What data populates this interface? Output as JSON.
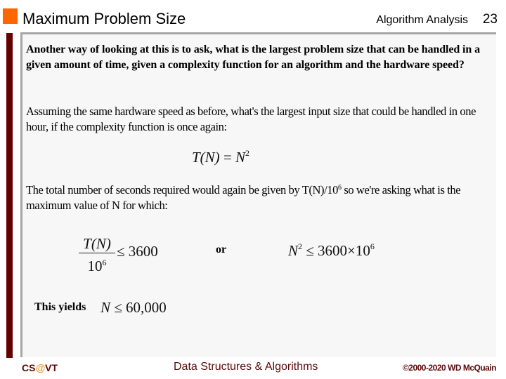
{
  "header": {
    "title": "Maximum Problem Size",
    "section": "Algorithm Analysis",
    "slide_number": "23",
    "accent_color": "#ff6600",
    "bar_color": "#660000"
  },
  "body": {
    "paragraph1": "Another way of looking at this is to ask, what is the largest problem size that can be handled in a given amount of time, given a complexity function for an algorithm and the hardware speed?",
    "paragraph2": "Assuming the same hardware speed as before, what's the largest input size that could be handled in one hour, if the complexity function is once again:",
    "equation1": {
      "lhs": "T(N)",
      "op": " = ",
      "rhs_base": "N",
      "rhs_exp": "2"
    },
    "paragraph3_pre": "The total number of seconds required would again be given by T(N)/10",
    "paragraph3_exp": "6",
    "paragraph3_post": " so we're asking what is the maximum value of N for which:",
    "inequality1": {
      "numerator": "T(N)",
      "denominator_base": "10",
      "denominator_exp": "6",
      "rhs": "≤ 3600"
    },
    "or_label": "or",
    "inequality2": {
      "lhs_base": "N",
      "lhs_exp": "2",
      "rhs": " ≤ 3600×10",
      "rhs_exp": "6"
    },
    "yields_label": "This yields",
    "result": {
      "var": "N",
      "rhs": " ≤ 60,000"
    }
  },
  "footer": {
    "left_prefix": "CS",
    "left_at": "@",
    "left_suffix": "VT",
    "center": "Data Structures & Algorithms",
    "right": "©2000-2020 WD McQuain"
  }
}
